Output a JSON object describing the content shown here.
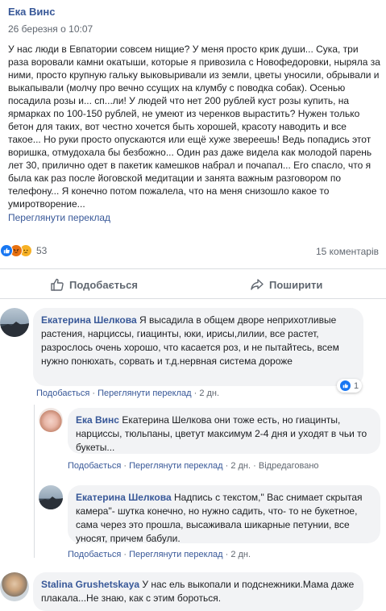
{
  "post": {
    "author": "Ека Винс",
    "time": "26 березня о 10:07",
    "text": "У нас люди в Евпатории совсем нищие? У меня просто крик души... Сука, три раза воровали камни окатыши, которые я привозила с Новофедоровки, ныряла за ними, просто крупную гальку выковыривали из земли, цветы уносили, обрывали и выкапывали (молчу про вечно ссущих на клумбу с поводка собак). Осенью посадила розы и... сп...ли! У людей что нет 200 рублей куст розы купить, на ярмарках по 100-150 рублей, не умеют из черенков вырастить? Нужен только бетон для таких, вот честно хочется быть хорошей, красоту наводить и все такое... Но руки просто опускаются или ещё хуже звереешь! Ведь попадись этот воришка, отмудохала бы безбожно... Один раз даже видела как молодой парень лет 30, прилично одет в пакетик камешков набрал и почапал... Его спасло, что я была как раз после йоговской медитации и занята важным разговором по телефону... Я конечно потом пожалела, что на меня снизошло какое то умиротворение...",
    "translate_label": "Переглянути переклад",
    "reaction_count": "53",
    "comments_count": "15 коментарів"
  },
  "actions": {
    "like_label": "Подобається",
    "share_label": "Поширити"
  },
  "comments": [
    {
      "author": "Екатерина Шелкова",
      "text": "Я высадила в общем дворе неприхотливые растения, нарциссы, гиацинты, юки, ирисы,лилии, все растет, разрослось очень хорошо, что касается роз, и не пытайтесь, всем нужно понюхать, сорвать и т.д.нервная система дороже",
      "like": "Подобається",
      "translate": "Переглянути переклад",
      "time": "2 дн.",
      "reactions": "1"
    },
    {
      "author": "Ека Винс",
      "text": "Екатерина Шелкова они тоже есть, но гиацинты, нарциссы, тюльпаны, цветут максимум 2-4 дня и уходят в чьи то букеты...",
      "like": "Подобається",
      "translate": "Переглянути переклад",
      "time": "2 дн.",
      "edited": "Відредаговано"
    },
    {
      "author": "Екатерина Шелкова",
      "text": "Надпись с текстом,\" Вас снимает скрытая камера\"- шутка конечно, но нужно садить, что- то не букетное, сама через это прошла, высаживала шикарные петунии, все уносят, причем бабули.",
      "like": "Подобається",
      "translate": "Переглянути переклад",
      "time": "2 дн."
    },
    {
      "author": "Stalina Grushetskaya",
      "text": "У нас ель выкопали и подснежники.Мама даже плакала...Не знаю, как с этим бороться."
    }
  ],
  "separator": "·",
  "colors": {
    "link": "#385898",
    "muted": "#606770",
    "bubble": "#f2f3f5",
    "like_blue": "#1877f2"
  }
}
